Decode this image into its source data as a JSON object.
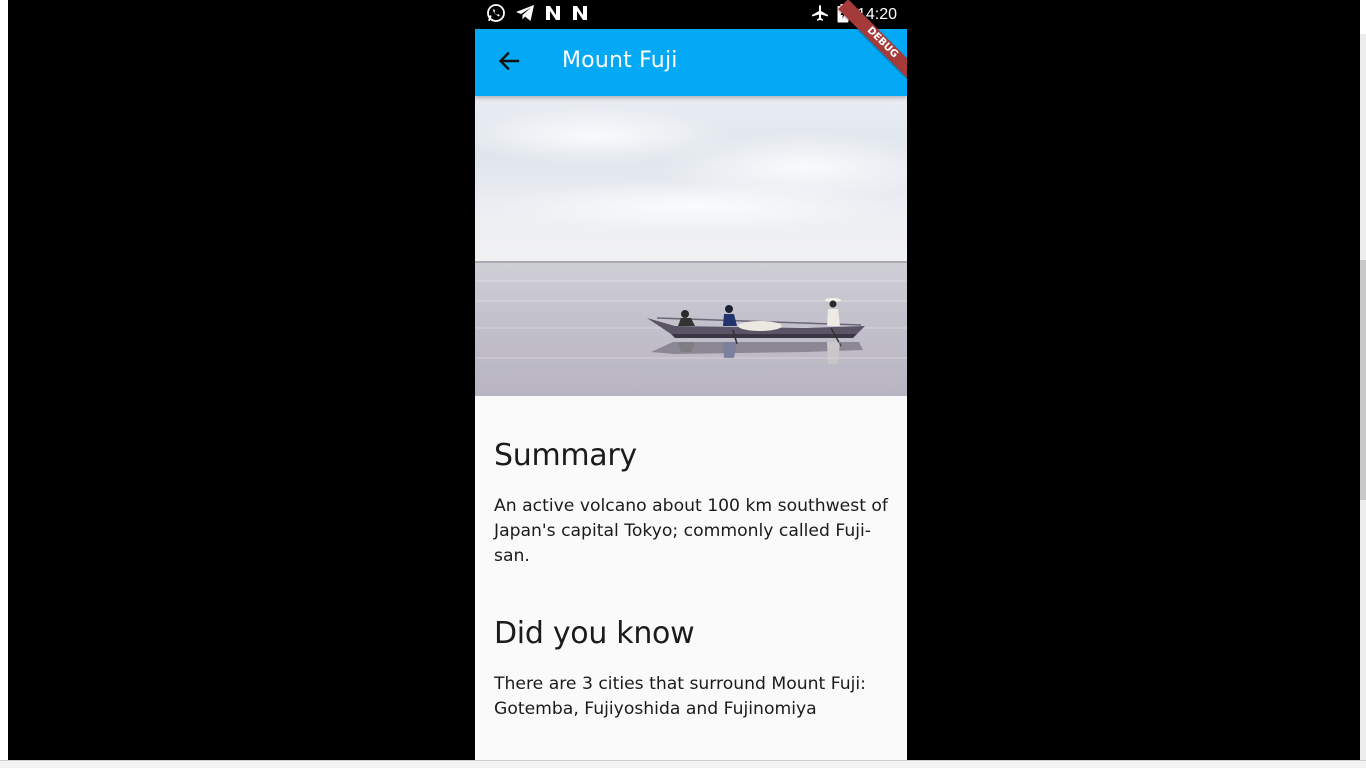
{
  "status_bar": {
    "time": "14:20",
    "left_icons": [
      "whatsapp-icon",
      "telegram-icon",
      "n-app-icon",
      "n-app-icon"
    ],
    "right_icons": [
      "airplane-mode-icon",
      "battery-charging-icon"
    ]
  },
  "app_bar": {
    "title": "Mount Fuji",
    "back_icon": "arrow-left-icon",
    "color": "#03a9f4",
    "debug_banner": "DEBUG"
  },
  "hero_image": {
    "description_icon": "boat-on-lake-photo"
  },
  "sections": {
    "summary": {
      "heading": "Summary",
      "body": "An active volcano about 100 km southwest of Japan's capital Tokyo; commonly called Fuji-san."
    },
    "did_you_know": {
      "heading": "Did you know",
      "body": "There are 3 cities that surround Mount Fuji: Gotemba, Fujiyoshida and Fujinomiya"
    }
  }
}
